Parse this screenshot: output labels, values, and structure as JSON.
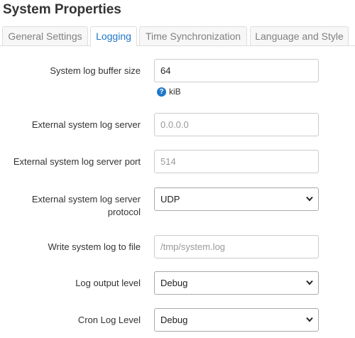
{
  "page": {
    "title": "System Properties"
  },
  "tabs": [
    {
      "label": "General Settings",
      "active": false
    },
    {
      "label": "Logging",
      "active": true
    },
    {
      "label": "Time Synchronization",
      "active": false
    },
    {
      "label": "Language and Style",
      "active": false
    }
  ],
  "fields": {
    "log_buffer": {
      "label": "System log buffer size",
      "value": "64",
      "help_unit": "kiB"
    },
    "log_server": {
      "label": "External system log server",
      "placeholder": "0.0.0.0"
    },
    "log_port": {
      "label": "External system log server port",
      "placeholder": "514"
    },
    "log_protocol": {
      "label_line1": "External system log server",
      "label_line2": "protocol",
      "selected": "UDP"
    },
    "log_file": {
      "label": "Write system log to file",
      "placeholder": "/tmp/system.log"
    },
    "log_level": {
      "label": "Log output level",
      "selected": "Debug"
    },
    "cron_level": {
      "label": "Cron Log Level",
      "selected": "Debug"
    }
  },
  "icons": {
    "help": "help-icon",
    "dropdown": "chevron-down-icon"
  },
  "colors": {
    "accent": "#1f77c8"
  }
}
